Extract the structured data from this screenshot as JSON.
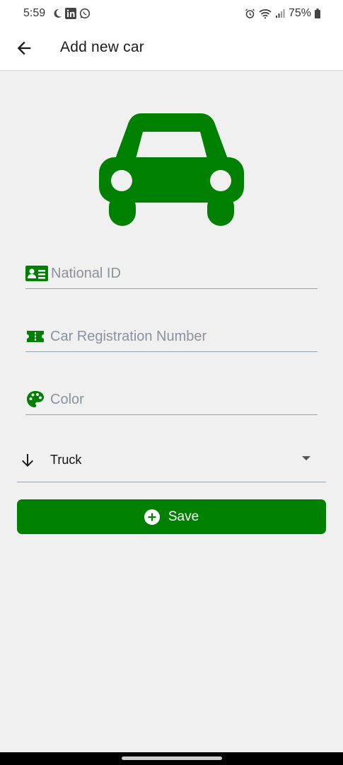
{
  "status_bar": {
    "time": "5:59",
    "battery": "75%",
    "icons": [
      "moon-icon",
      "linkedin-icon",
      "whatsapp-icon",
      "alarm-icon",
      "wifi-icon",
      "signal-icon",
      "battery-icon"
    ]
  },
  "app_bar": {
    "title": "Add new car",
    "back_icon": "arrow-back-icon"
  },
  "hero": {
    "icon": "car-icon",
    "color": "#008000"
  },
  "form": {
    "national_id": {
      "placeholder": "National ID",
      "value": "",
      "icon": "id-card-icon"
    },
    "registration": {
      "placeholder": "Car Registration Number",
      "value": "",
      "icon": "ticket-icon"
    },
    "color": {
      "placeholder": "Color",
      "value": "",
      "icon": "palette-icon"
    },
    "type_dropdown": {
      "selected": "Truck",
      "icon": "arrow-down-icon"
    }
  },
  "save_button": {
    "label": "Save",
    "icon": "add-circle-icon"
  },
  "colors": {
    "accent": "#008000",
    "background": "#f0f0f0",
    "divider": "#9aa3ad"
  }
}
